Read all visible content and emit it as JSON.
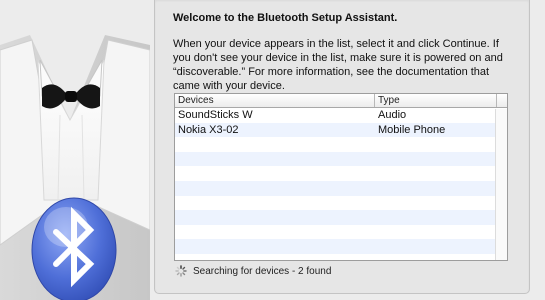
{
  "assistant": {
    "title": "Welcome to the Bluetooth Setup Assistant.",
    "description": "When your device appears in the list, select it and click Continue. If you don't see your device in the list, make sure it is powered on and “discoverable.” For more information, see the documentation that came with your device."
  },
  "device_table": {
    "columns": {
      "devices": "Devices",
      "type": "Type"
    },
    "rows": [
      {
        "device": "SoundSticks W",
        "type": "Audio"
      },
      {
        "device": "Nokia X3-02",
        "type": "Mobile Phone"
      },
      {
        "device": "",
        "type": ""
      },
      {
        "device": "",
        "type": ""
      },
      {
        "device": "",
        "type": ""
      },
      {
        "device": "",
        "type": ""
      },
      {
        "device": "",
        "type": ""
      },
      {
        "device": "",
        "type": ""
      },
      {
        "device": "",
        "type": ""
      },
      {
        "device": "",
        "type": ""
      },
      {
        "device": "",
        "type": ""
      }
    ]
  },
  "status": {
    "text": "Searching for devices - 2 found",
    "icon": "spinner-icon"
  },
  "illustration": {
    "icon": "bluetooth-icon",
    "accent": "#4f6fd8"
  }
}
